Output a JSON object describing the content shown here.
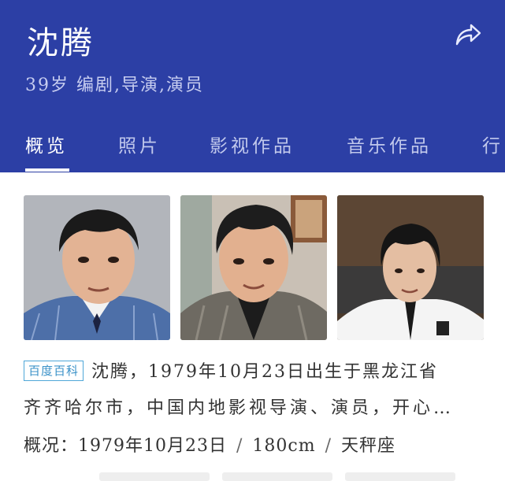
{
  "header": {
    "name": "沈腾",
    "subtitle": "39岁  编剧,导演,演员",
    "share_icon": "share-icon"
  },
  "tabs": [
    {
      "label": "概览",
      "active": true
    },
    {
      "label": "照片",
      "active": false
    },
    {
      "label": "影视作品",
      "active": false
    },
    {
      "label": "音乐作品",
      "active": false
    },
    {
      "label": "行",
      "active": false
    }
  ],
  "photos": [
    {
      "label": "photo-1"
    },
    {
      "label": "photo-2"
    },
    {
      "label": "photo-3"
    }
  ],
  "intro": {
    "badge": "百度百科",
    "line1": "沈腾，1979年10月23日出生于黑龙江省",
    "line2": "齐齐哈尔市，中国内地影视导演、演员，开心…"
  },
  "overview": {
    "label": "概况：",
    "birthday": "1979年10月23日",
    "height": "180cm",
    "zodiac": "天秤座",
    "separator": "/"
  },
  "colors": {
    "header_bg": "#2c3fa5",
    "badge": "#3b92c8"
  }
}
